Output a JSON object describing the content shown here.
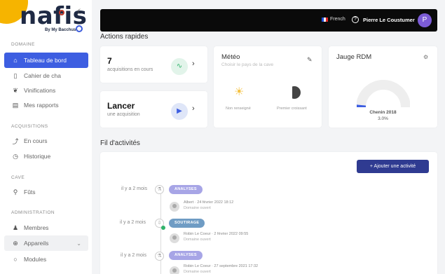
{
  "brand": {
    "logo_text": "nafis",
    "logo_sub": "By My Bacchus"
  },
  "sidebar": {
    "sections": [
      {
        "label": "DOMAINE"
      },
      {
        "label": "ACQUISITIONS"
      },
      {
        "label": "CAVE"
      },
      {
        "label": "ADMINISTRATION"
      }
    ],
    "items": [
      {
        "label": "Tableau de bord",
        "icon": "home-icon"
      },
      {
        "label": "Cahier de cha",
        "icon": "book-icon"
      },
      {
        "label": "Vinifications",
        "icon": "grape-icon"
      },
      {
        "label": "Mes rapports",
        "icon": "report-icon"
      },
      {
        "label": "En cours",
        "icon": "trend-icon"
      },
      {
        "label": "Historique",
        "icon": "clock-icon"
      },
      {
        "label": "Fûts",
        "icon": "barrel-icon"
      },
      {
        "label": "Membres",
        "icon": "users-icon"
      },
      {
        "label": "Appareils",
        "icon": "device-icon"
      },
      {
        "label": "Modules",
        "icon": "module-icon"
      }
    ]
  },
  "topbar": {
    "language": "French",
    "user_name": "Pierre Le Coustumer",
    "avatar_initial": "P"
  },
  "quick_actions": {
    "heading": "Actions rapides",
    "acquisitions": {
      "count": "7",
      "subtitle": "acquisitions en cours"
    },
    "launch": {
      "title": "Lancer",
      "subtitle": "une acquisition"
    }
  },
  "meteo": {
    "title": "Météo",
    "subtitle": "Choisir le pays de la cave",
    "caption_left": "Non renseigné",
    "caption_right": "Premier croissant"
  },
  "rdm": {
    "title": "Jauge RDM",
    "label": "Chenin 2018",
    "value": "3.0%",
    "gauge_fraction": 0.03
  },
  "feed": {
    "heading": "Fil d'activités",
    "add_button": "+ Ajouter une activité",
    "entries": [
      {
        "time": "il y a 2 mois",
        "tag": "ANALYSES",
        "meta": "Albert · 24 février 2022 18:12",
        "sub": "Domaine ouvert"
      },
      {
        "time": "il y a 2 mois",
        "tag": "SOUTIRAGE",
        "meta": "Robin Le Coeur · 2 février 2022 09:55",
        "sub": "Domaine ouvert"
      },
      {
        "time": "il y a 2 mois",
        "tag": "ANALYSES",
        "meta": "Robin Le Coeur · 27 septembre 2021 17:32",
        "sub": "Domaine ouvert"
      }
    ]
  },
  "colors": {
    "accent": "#3d5ee1",
    "analyses_pill": "#a7a5e6",
    "soutirage_pill": "#6f9cc4",
    "gauge_track": "#eeeeee",
    "gauge_fill": "#3d5ee1"
  }
}
